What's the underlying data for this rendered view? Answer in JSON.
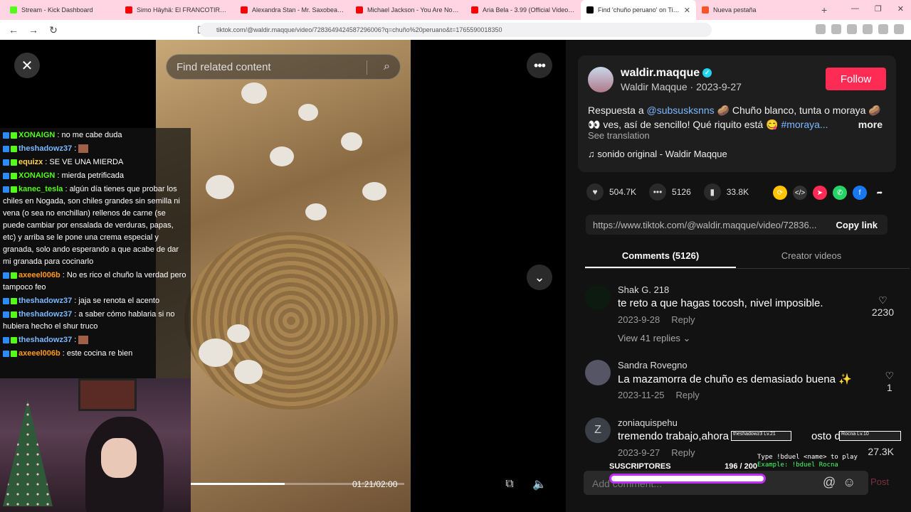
{
  "browser": {
    "tabs": [
      {
        "title": "Stream - Kick Dashboard",
        "color": "#53fc18"
      },
      {
        "title": "Simo Häyhä: El FRANCOTIRADOR m",
        "color": "#ff0000"
      },
      {
        "title": "Alexandra Stan - Mr. Saxobeat (O",
        "color": "#ff0000"
      },
      {
        "title": "Michael Jackson - You Are Not Alone",
        "color": "#ff0000"
      },
      {
        "title": "Aria Bela - 3.99 (Official Video) - You",
        "color": "#ff0000"
      },
      {
        "title": "Find 'chuño peruano' on TikT",
        "color": "#000000",
        "active": true
      },
      {
        "title": "Nueva pestaña",
        "color": "#fb542b"
      }
    ],
    "url": "tiktok.com/@waldir.maqque/video/7283649424587296006?q=chuño%20peruano&t=1765590018350"
  },
  "video": {
    "search_placeholder": "Find related content",
    "time": "01:21/02:00",
    "progress": 0.44
  },
  "chat": [
    {
      "user": "XONAIGN",
      "text": ": no me cabe duda",
      "color": "#53fc18"
    },
    {
      "user": "theshadowz37",
      "text": ":",
      "color": "#7ab8ff",
      "emote": true
    },
    {
      "user": "equizx",
      "text": ": SE VE UNA MIERDA",
      "color": "#ffd34e"
    },
    {
      "user": "XONAIGN",
      "text": ": mierda petrificada",
      "color": "#53fc18"
    },
    {
      "user": "kanec_tesla",
      "text": ": algún día tienes que probar los chiles en Nogada, son chiles grandes sin semilla ni vena (o sea no enchillan) rellenos de carne (se puede cambiar por ensalada de verduras, papas, etc) y arriba se le pone una crema especial y granada, solo ando esperando a que acabe de dar mi granada para cocinarlo",
      "color": "#53fc18"
    },
    {
      "user": "axeeel006b",
      "text": ": No es rico el chuño la verdad pero tampoco feo",
      "color": "#ff9a1f"
    },
    {
      "user": "theshadowz37",
      "text": ": jaja se renota el acento",
      "color": "#7ab8ff"
    },
    {
      "user": "theshadowz37",
      "text": ": a saber cómo hablaria si no hubiera hecho el shur truco",
      "color": "#7ab8ff"
    },
    {
      "user": "theshadowz37",
      "text": ":",
      "color": "#7ab8ff",
      "emote": true
    },
    {
      "user": "axeeel006b",
      "text": ": este cocina re bien",
      "color": "#ff9a1f"
    }
  ],
  "author": {
    "handle": "waldir.maqque",
    "sub": "Waldir Maqque · 2023-9-27",
    "follow": "Follow",
    "desc_prefix": "Respuesta a ",
    "mention": "@subsusksnns",
    "desc_body": " 🥔 Chuño blanco, tunta o moraya 🥔 👀 ves, así de sencillo! Qué riquito está 😋 ",
    "hashtag": "#moraya...",
    "more": "more",
    "see_translation": "See translation",
    "sound": "♫  sonido original - Waldir Maqque"
  },
  "stats": {
    "likes": "504.7K",
    "comments": "5126",
    "saves": "33.8K"
  },
  "link": {
    "url": "https://www.tiktok.com/@waldir.maqque/video/72836...",
    "copy": "Copy link"
  },
  "tabs": {
    "comments": "Comments (5126)",
    "creator": "Creator videos"
  },
  "comments": [
    {
      "user": "Shak G. 218",
      "text": "te reto a que hagas tocosh, nivel imposible.",
      "date": "2023-9-28",
      "reply": "Reply",
      "likes": "2230",
      "views": "View 41 replies ⌄"
    },
    {
      "user": "Sandra Rovegno",
      "text": "La mazamorra de chuño es demasiado buena ✨",
      "date": "2023-11-25",
      "reply": "Reply",
      "likes": "1"
    },
    {
      "user": "zoniaquispehu",
      "text": "tremendo trabajo,ahora",
      "text_tail": "osto del ch",
      "date": "2023-9-27",
      "reply": "Reply",
      "likes": "27.3K"
    }
  ],
  "overlay": {
    "subs_label": "SUSCRIPTORES",
    "subs_count": "196 / 200",
    "duel_line": "Type !bduel <name> to play",
    "duel_example": "Example: !bduel Rocna",
    "hp1": "theshadowz3 Lv.21",
    "hp2": "Rocna Lv.10"
  },
  "addcomment": {
    "placeholder": "Add comment...",
    "post": "Post"
  }
}
